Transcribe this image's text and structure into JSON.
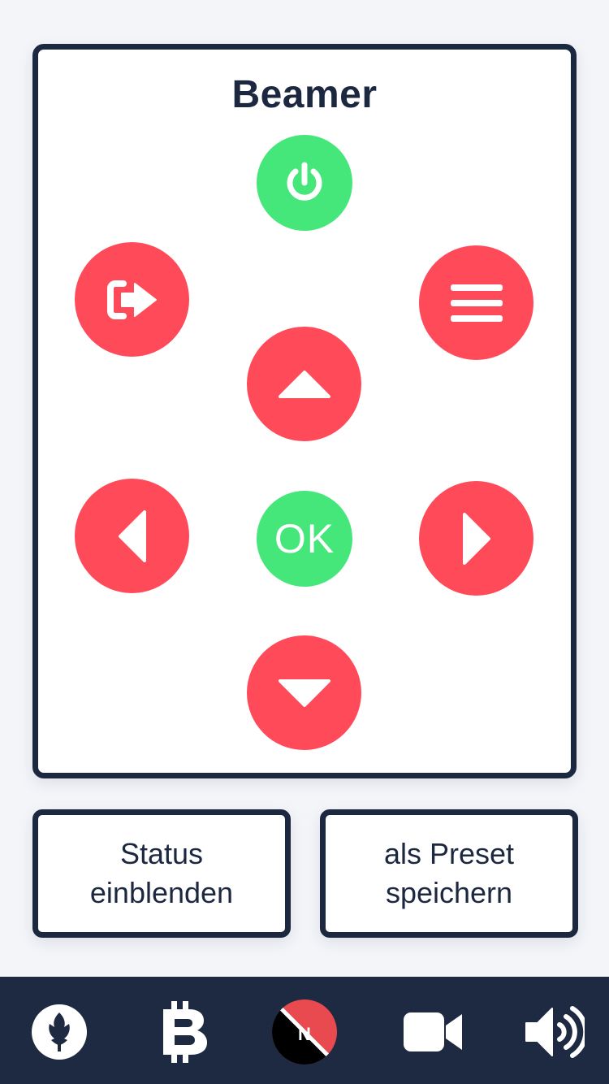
{
  "remote": {
    "title": "Beamer",
    "buttons": {
      "power": {
        "icon": "power-icon",
        "color": "#45e67a"
      },
      "input": {
        "icon": "sign-out-icon",
        "color": "#ff4a5a"
      },
      "menu": {
        "icon": "menu-bars-icon",
        "color": "#ff4a5a"
      },
      "up": {
        "icon": "caret-up-icon",
        "color": "#ff4a5a"
      },
      "left": {
        "icon": "caret-left-icon",
        "color": "#ff4a5a"
      },
      "ok": {
        "label": "OK",
        "color": "#45e67a"
      },
      "right": {
        "icon": "caret-right-icon",
        "color": "#ff4a5a"
      },
      "down": {
        "icon": "caret-down-icon",
        "color": "#ff4a5a"
      }
    }
  },
  "actions": {
    "status_label": "Status\neinblenden",
    "preset_label": "als Preset\nspeichern"
  },
  "bottom_nav": {
    "items": [
      {
        "icon": "rebel-alliance-icon"
      },
      {
        "icon": "bitcoin-icon"
      },
      {
        "icon": "no-signal-badge-icon",
        "label": "N"
      },
      {
        "icon": "video-camera-icon"
      },
      {
        "icon": "volume-up-icon"
      }
    ]
  },
  "colors": {
    "accent_red": "#ff4a5a",
    "accent_green": "#45e67a",
    "dark": "#1c2840",
    "nav_bg": "#1e2a42"
  }
}
